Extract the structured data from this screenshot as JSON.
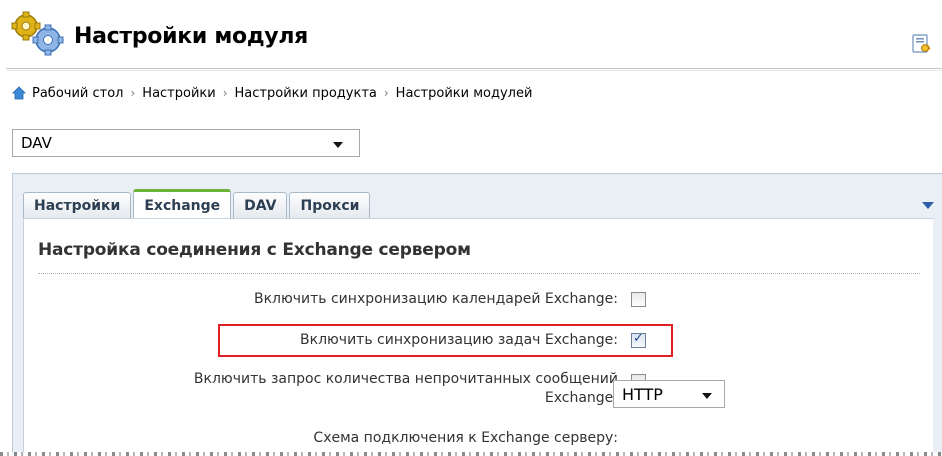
{
  "header": {
    "title": "Настройки модуля",
    "logo_icon": "gears-icon",
    "help_icon": "help-link-icon"
  },
  "breadcrumb": {
    "home_icon": "home-icon",
    "items": [
      "Рабочий стол",
      "Настройки",
      "Настройки продукта",
      "Настройки модулей"
    ],
    "separator": "›"
  },
  "module_select": {
    "value": "DAV"
  },
  "tabs": [
    {
      "label": "Настройки",
      "active": false
    },
    {
      "label": "Exchange",
      "active": true
    },
    {
      "label": "DAV",
      "active": false
    },
    {
      "label": "Прокси",
      "active": false
    }
  ],
  "section": {
    "title": "Настройка соединения с Exchange сервером"
  },
  "options": {
    "calendar_sync": {
      "label": "Включить синхронизацию календарей Exchange:",
      "checked": false
    },
    "tasks_sync": {
      "label": "Включить синхронизацию задач Exchange:",
      "checked": true
    },
    "unread_count_line1": "Включить запрос количества непрочитанных сообщений",
    "unread_count_line2": "Exchange:",
    "unread_count_checked": false,
    "connection_scheme": {
      "label": "Схема подключения к Exchange серверу:",
      "value": "HTTP"
    }
  },
  "colors": {
    "highlight_border": "#e01e25",
    "active_tab_accent": "#6cb437",
    "panel_bg": "#e9eff5"
  }
}
